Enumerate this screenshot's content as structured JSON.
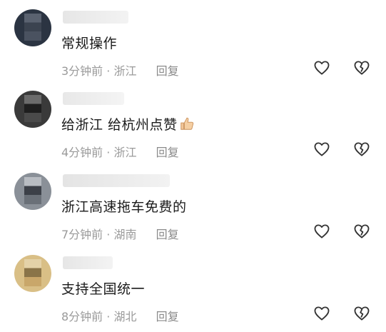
{
  "comments": [
    {
      "text": "常规操作",
      "time": "3分钟前",
      "location": "浙江",
      "reply_label": "回复",
      "avatar_colors": [
        "#2b3442",
        "#5a6270",
        "#1a1f28"
      ]
    },
    {
      "text": "给浙江   给杭州点赞",
      "time": "4分钟前",
      "location": "浙江",
      "reply_label": "回复",
      "avatar_colors": [
        "#3a3a3a",
        "#6b6b6b",
        "#222222"
      ]
    },
    {
      "text": "浙江高速拖车免费的",
      "time": "7分钟前",
      "location": "湖南",
      "reply_label": "回复",
      "avatar_colors": [
        "#6a7078",
        "#b8bcc2",
        "#3c4048"
      ]
    },
    {
      "text": "支持全国统一",
      "time": "8分钟前",
      "location": "湖北",
      "reply_label": "回复",
      "avatar_colors": [
        "#c9a76a",
        "#e4d2a8",
        "#8a7448"
      ]
    }
  ],
  "separator": "·",
  "icons": {
    "like": "heart-icon",
    "dislike": "broken-heart-icon",
    "emoji": "thumbs-up-emoji-icon"
  },
  "colors": {
    "text": "#1a1a1a",
    "meta": "#9a9a9a",
    "icon_stroke": "#333333"
  }
}
